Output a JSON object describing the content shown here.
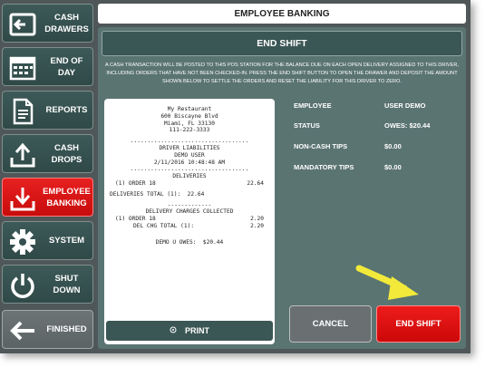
{
  "header": {
    "title": "EMPLOYEE BANKING"
  },
  "sidebar": {
    "items": [
      {
        "label": "CASH\nDRAWERS",
        "icon": "cash-drawers-icon"
      },
      {
        "label": "END OF\nDAY",
        "icon": "calendar-icon"
      },
      {
        "label": "REPORTS",
        "icon": "document-icon"
      },
      {
        "label": "CASH\nDROPS",
        "icon": "upload-tray-icon"
      },
      {
        "label": "EMPLOYEE\nBANKING",
        "icon": "download-tray-icon",
        "active": true
      },
      {
        "label": "SYSTEM",
        "icon": "gear-icon"
      },
      {
        "label": "SHUT\nDOWN",
        "icon": "power-icon"
      },
      {
        "label": "FINISHED",
        "icon": "arrow-left-icon"
      }
    ]
  },
  "main": {
    "heading": "END SHIFT",
    "instructions": "A cash transaction will be posted to this POS station for the balance due on each open delivery assigned to this driver, including orders that have not been checked-in. Press the End Shift button to open the drawer and deposit the amount shown below to settle the orders and reset the liability for this driver to zero.",
    "receipt": {
      "restaurant": "My Restaurant",
      "address": "600 Biscayne Blvd",
      "city": "Miami, FL 33130",
      "phone": "111-222-3333",
      "separator": "...................................",
      "title": "DRIVER LIABILITIES",
      "user": "DEMO USER",
      "datetime": "2/11/2016 10:48:48 AM",
      "deliveries_heading": "DELIVERIES",
      "order_line": "(1) ORDER 18",
      "order_amount": "22.64",
      "deliveries_total": "DELIVERIES TOTAL (1):  22.64",
      "short_separator": "-------------",
      "charges_heading": "DELIVERY CHARGES COLLECTED",
      "charge_order_line": "(1) ORDER 18",
      "charge_order_amount": "2.20",
      "charge_detail": "DEL CHG TOTAL (1):",
      "charge_detail_amount": "2.20",
      "owes_line": "DEMO U OWES:  $20.44"
    },
    "print_label": "PRINT",
    "print_icon": "printer-icon",
    "details": [
      {
        "key": "EMPLOYEE",
        "value": "USER DEMO"
      },
      {
        "key": "STATUS",
        "value": "OWES:  $20.44"
      },
      {
        "key": "NON-CASH TIPS",
        "value": "$0.00"
      },
      {
        "key": "MANDATORY TIPS",
        "value": "$0.00"
      }
    ],
    "cancel_label": "CANCEL",
    "end_shift_label": "END SHIFT"
  },
  "colors": {
    "panel": "#5a7472",
    "button_dark": "#3b5755",
    "accent_red": "#e01515",
    "annotation_arrow": "#f2e93a"
  }
}
